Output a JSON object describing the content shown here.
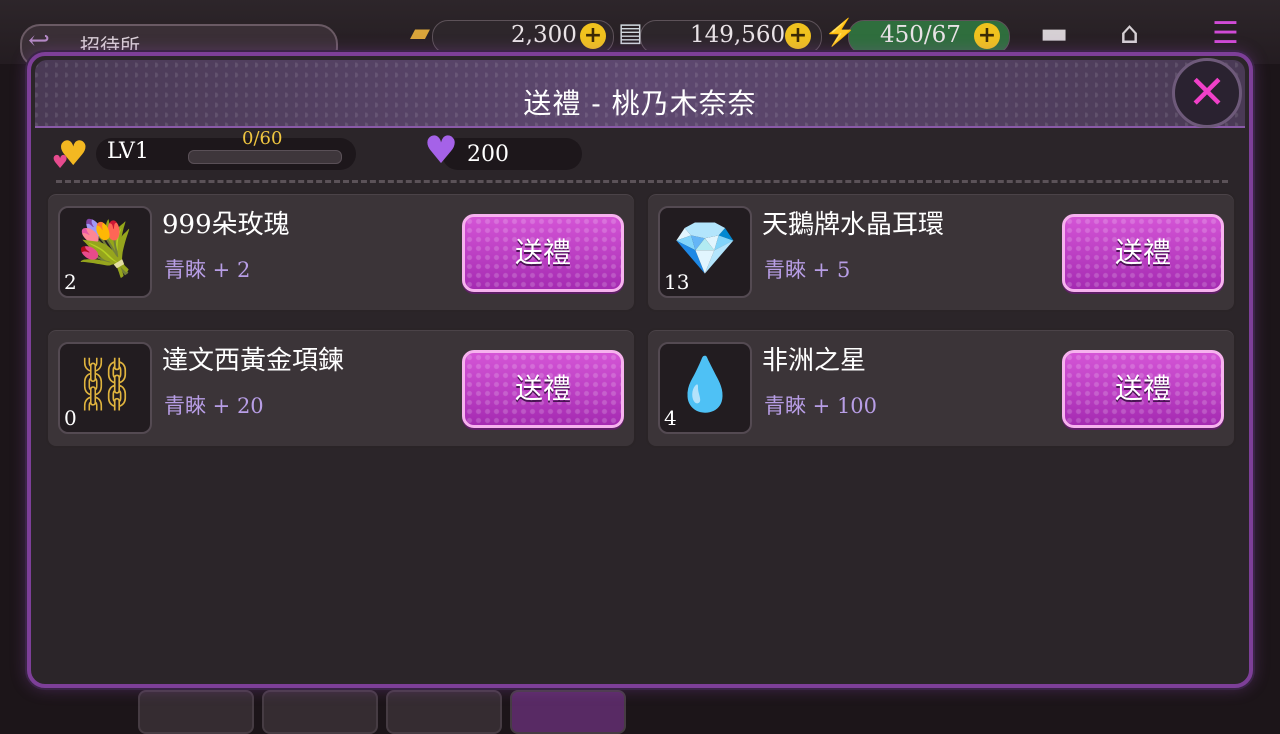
{
  "hud": {
    "back_label": "招待所",
    "gold": "2,300",
    "cash": "149,560",
    "energy": "450/67",
    "plus": "+"
  },
  "dialog": {
    "title": "送禮 - 桃乃木奈奈",
    "close_glyph": "✕",
    "level": "LV1",
    "exp_text": "0/60",
    "exp_fraction": 0,
    "gems": "200"
  },
  "gifts": [
    {
      "name": "999朵玫瑰",
      "bonus": "青睞 + 2",
      "qty": "2",
      "button": "送禮",
      "art": "💐"
    },
    {
      "name": "天鵝牌水晶耳環",
      "bonus": "青睞 + 5",
      "qty": "13",
      "button": "送禮",
      "art": "💎"
    },
    {
      "name": "達文西黃金項鍊",
      "bonus": "青睞 + 20",
      "qty": "0",
      "button": "送禮",
      "art": "⛓"
    },
    {
      "name": "非洲之星",
      "bonus": "青睞 + 100",
      "qty": "4",
      "button": "送禮",
      "art": "💧"
    }
  ],
  "colors": {
    "accent": "#c040c8",
    "frame": "#7d3f98",
    "bonus_text": "#b89ee6",
    "exp_text": "#f0c640"
  }
}
